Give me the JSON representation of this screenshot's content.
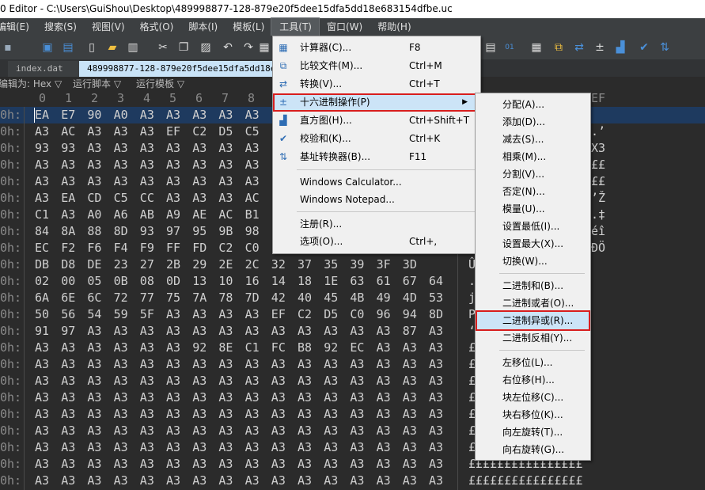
{
  "window": {
    "title": "0 Editor - C:\\Users\\GuiShou\\Desktop\\489998877-128-879e20f5dee15dfa5dd18e683154dfbe.uc"
  },
  "menubar": [
    {
      "label": "编辑(E)"
    },
    {
      "label": "搜索(S)"
    },
    {
      "label": "视图(V)"
    },
    {
      "label": "格式(O)"
    },
    {
      "label": "脚本(I)"
    },
    {
      "label": "模板(L)"
    },
    {
      "label": "工具(T)"
    },
    {
      "label": "窗口(W)"
    },
    {
      "label": "帮助(H)"
    }
  ],
  "tabs": [
    {
      "label": "index.dat"
    },
    {
      "label": "489998877-128-879e20f5dee15dfa5dd18e683154dfbe.uc"
    }
  ],
  "subbar": {
    "edit_as": "编辑为: Hex ▽",
    "run_script": "运行脚本 ▽",
    "run_template": "运行模板 ▽"
  },
  "column_headers": [
    "0",
    "1",
    "2",
    "3",
    "4",
    "5",
    "6",
    "7",
    "8"
  ],
  "ascii_header": "EF",
  "rows": [
    {
      "addr": "0h:",
      "bytes": [
        "EA",
        "E7",
        "90",
        "A0",
        "A3",
        "A3",
        "A3",
        "A3",
        "A3"
      ],
      "ascii": ""
    },
    {
      "addr": "0h:",
      "bytes": [
        "A3",
        "AC",
        "A3",
        "A3",
        "A3",
        "EF",
        "C2",
        "D5",
        "C5"
      ],
      "ascii": ".’"
    },
    {
      "addr": "0h:",
      "bytes": [
        "93",
        "93",
        "A3",
        "A3",
        "A3",
        "A3",
        "A3",
        "A3",
        "A3"
      ],
      "ascii": "X3"
    },
    {
      "addr": "0h:",
      "bytes": [
        "A3",
        "A3",
        "A3",
        "A3",
        "A3",
        "A3",
        "A3",
        "A3",
        "A3"
      ],
      "ascii": "££"
    },
    {
      "addr": "0h:",
      "bytes": [
        "A3",
        "A3",
        "A3",
        "A3",
        "A3",
        "A3",
        "A3",
        "A3",
        "A3"
      ],
      "ascii": "££"
    },
    {
      "addr": "0h:",
      "bytes": [
        "A3",
        "EA",
        "CD",
        "C5",
        "CC",
        "A3",
        "A3",
        "A3",
        "AC"
      ],
      "ascii": "’Ž"
    },
    {
      "addr": "0h:",
      "bytes": [
        "C1",
        "A3",
        "A0",
        "A6",
        "AB",
        "A9",
        "AE",
        "AC",
        "B1"
      ],
      "ascii": ".‡"
    },
    {
      "addr": "0h:",
      "bytes": [
        "84",
        "8A",
        "88",
        "8D",
        "93",
        "97",
        "95",
        "9B",
        "98"
      ],
      "ascii": "éî"
    },
    {
      "addr": "0h:",
      "bytes": [
        "EC",
        "F2",
        "F6",
        "F4",
        "F9",
        "FF",
        "FD",
        "C2",
        "C0"
      ],
      "ascii": "ÐÖ"
    },
    {
      "addr": "0h:",
      "bytes": [
        "DB",
        "D8",
        "DE",
        "23",
        "27",
        "2B",
        "29",
        "2E",
        "2C",
        "32",
        "37",
        "35",
        "39",
        "3F",
        "3D"
      ],
      "ascii": "Û   ?="
    },
    {
      "addr": "0h:",
      "bytes": [
        "02",
        "00",
        "05",
        "0B",
        "08",
        "0D",
        "13",
        "10",
        "16",
        "14",
        "18",
        "1E",
        "63",
        "61",
        "67",
        "64"
      ],
      "ascii": ".      gd"
    },
    {
      "addr": "0h:",
      "bytes": [
        "6A",
        "6E",
        "6C",
        "72",
        "77",
        "75",
        "7A",
        "78",
        "7D",
        "42",
        "40",
        "45",
        "4B",
        "49",
        "4D",
        "53"
      ],
      "ascii": "j      MS"
    },
    {
      "addr": "0h:",
      "bytes": [
        "50",
        "56",
        "54",
        "59",
        "5F",
        "A3",
        "A3",
        "A3",
        "A3",
        "EF",
        "C2",
        "D5",
        "C0",
        "96",
        "94",
        "8D"
      ],
      "ascii": "P     ”."
    },
    {
      "addr": "0h:",
      "bytes": [
        "91",
        "97",
        "A3",
        "A3",
        "A3",
        "A3",
        "A3",
        "A3",
        "A3",
        "A3",
        "A3",
        "A3",
        "A3",
        "A3",
        "87",
        "A3"
      ],
      "ascii": "‘     ‡£"
    },
    {
      "addr": "0h:",
      "bytes": [
        "A3",
        "A3",
        "A3",
        "A3",
        "A3",
        "A3",
        "92",
        "8E",
        "C1",
        "FC",
        "B8",
        "92",
        "EC",
        "A3",
        "A3",
        "A3"
      ],
      "ascii": "£££££££££££££££"
    },
    {
      "addr": "0h:",
      "bytes": [
        "A3",
        "A3",
        "A3",
        "A3",
        "A3",
        "A3",
        "A3",
        "A3",
        "A3",
        "A3",
        "A3",
        "A3",
        "A3",
        "A3",
        "A3",
        "A3"
      ],
      "ascii": "££££££££££££££££"
    },
    {
      "addr": "0h:",
      "bytes": [
        "A3",
        "A3",
        "A3",
        "A3",
        "A3",
        "A3",
        "A3",
        "A3",
        "A3",
        "A3",
        "A3",
        "A3",
        "A3",
        "A3",
        "A3",
        "A3"
      ],
      "ascii": "££££££££££££££££"
    },
    {
      "addr": "0h:",
      "bytes": [
        "A3",
        "A3",
        "A3",
        "A3",
        "A3",
        "A3",
        "A3",
        "A3",
        "A3",
        "A3",
        "A3",
        "A3",
        "A3",
        "A3",
        "A3",
        "A3"
      ],
      "ascii": "££££££££££££££££"
    },
    {
      "addr": "0h:",
      "bytes": [
        "A3",
        "A3",
        "A3",
        "A3",
        "A3",
        "A3",
        "A3",
        "A3",
        "A3",
        "A3",
        "A3",
        "A3",
        "A3",
        "A3",
        "A3",
        "A3"
      ],
      "ascii": "££££££££££££££££"
    },
    {
      "addr": "0h:",
      "bytes": [
        "A3",
        "A3",
        "A3",
        "A3",
        "A3",
        "A3",
        "A3",
        "A3",
        "A3",
        "A3",
        "A3",
        "A3",
        "A3",
        "A3",
        "A3",
        "A3"
      ],
      "ascii": "££££££££££££££££"
    },
    {
      "addr": "0h:",
      "bytes": [
        "A3",
        "A3",
        "A3",
        "A3",
        "A3",
        "A3",
        "A3",
        "A3",
        "A3",
        "A3",
        "A3",
        "A3",
        "A3",
        "A3",
        "A3",
        "A3"
      ],
      "ascii": "££££££££££££££££"
    },
    {
      "addr": "0h:",
      "bytes": [
        "A3",
        "A3",
        "A3",
        "A3",
        "A3",
        "A3",
        "A3",
        "A3",
        "A3",
        "A3",
        "A3",
        "A3",
        "A3",
        "A3",
        "A3",
        "A3"
      ],
      "ascii": "££££££££££££££££"
    },
    {
      "addr": "0h:",
      "bytes": [
        "A3",
        "A3",
        "A3",
        "A3",
        "A3",
        "A3",
        "A3",
        "A3",
        "A3",
        "A3",
        "A3",
        "A3",
        "A3",
        "A3",
        "A3",
        "A3"
      ],
      "ascii": "££££££££££££££££"
    }
  ],
  "tools_menu": [
    {
      "label": "计算器(C)...",
      "shortcut": "F8",
      "icon": "calculator-icon",
      "glyph": "▦"
    },
    {
      "label": "比较文件(M)...",
      "shortcut": "Ctrl+M",
      "icon": "compare-files-icon",
      "glyph": "⧉"
    },
    {
      "label": "转换(V)...",
      "shortcut": "Ctrl+T",
      "icon": "convert-icon",
      "glyph": "⇄"
    },
    {
      "label": "十六进制操作(P)",
      "shortcut": "",
      "icon": "hex-operations-icon",
      "glyph": "±"
    },
    {
      "label": "直方图(H)...",
      "shortcut": "Ctrl+Shift+T",
      "icon": "histogram-icon",
      "glyph": "▟"
    },
    {
      "label": "校验和(K)...",
      "shortcut": "Ctrl+K",
      "icon": "checksum-icon",
      "glyph": "✔"
    },
    {
      "label": "基址转换器(B)...",
      "shortcut": "F11",
      "icon": "base-converter-icon",
      "glyph": "⇅"
    },
    {
      "label": "Windows Calculator...",
      "shortcut": ""
    },
    {
      "label": "Windows Notepad...",
      "shortcut": ""
    },
    {
      "label": "注册(R)...",
      "shortcut": ""
    },
    {
      "label": "选项(O)...",
      "shortcut": "Ctrl+,"
    }
  ],
  "hex_ops_submenu": [
    "分配(A)...",
    "添加(D)...",
    "减去(S)...",
    "相乘(M)...",
    "分割(V)...",
    "否定(N)...",
    "模量(U)...",
    "设置最低(I)...",
    "设置最大(X)...",
    "切换(W)...",
    "二进制和(B)...",
    "二进制或者(O)...",
    "二进制异或(R)...",
    "二进制反相(Y)...",
    "左移位(L)...",
    "右位移(H)...",
    "块左位移(C)...",
    "块右移位(K)...",
    "向左旋转(T)...",
    "向右旋转(G)..."
  ],
  "colors": {
    "highlight_border": "#d81e1e",
    "menu_bg": "#f0f0f0",
    "menu_hover": "#cce4f7",
    "editor_bg": "#2b2b2b"
  }
}
